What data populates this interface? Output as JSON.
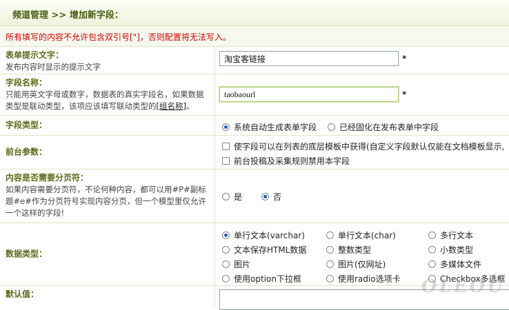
{
  "header": {
    "title": "频道管理 >> 增加新字段："
  },
  "warning": "所有填写的内容不允许包含双引号[\"]，否则配置将无法写入。",
  "form_label": {
    "title": "表单提示文字：",
    "desc": "发布内容时显示的提示文字",
    "value": "淘宝客链接",
    "required": "*"
  },
  "field_name": {
    "title": "字段名称：",
    "desc1": "只能用英文字母或数字，数据表的真实字段名，如果数据",
    "desc2": "类型是联动类型，该项应该填写联动类型的",
    "desc2_link": "[组名称]",
    "desc2_end": "。",
    "value": "taobaourl",
    "required": "*"
  },
  "field_type": {
    "title": "字段类型：",
    "options": [
      "系统自动生成表单字段",
      "已经固化在发布表单中字段"
    ]
  },
  "frontend": {
    "title": "前台参数：",
    "options": [
      "使字段可以在列表的底层模板中获得(自定义字段默认仅能在文档模板显示,",
      "前台投稿及采集规则禁用本字段"
    ]
  },
  "paging": {
    "title": "内容是否需要分页符：",
    "desc1": "如果内容需要分页符，不论何种内容，都可以用#P#副标",
    "desc2": "题#e#作为分页符号实现内容分页，但一个模型里仅允许",
    "desc3": "一个这样的字段!",
    "options": [
      "是",
      "否"
    ]
  },
  "data_type": {
    "title": "数据类型：",
    "options": [
      "单行文本(varchar)",
      "单行文本(char)",
      "多行文本",
      "文本保存HTML数据",
      "整数类型",
      "小数类型",
      "图片",
      "图片(仅网址)",
      "多媒体文件",
      "使用option下拉框",
      "使用radio选项卡",
      "Checkbox多选框"
    ]
  },
  "default_value": {
    "title": "默认值："
  },
  "watermark": "OLEOU"
}
